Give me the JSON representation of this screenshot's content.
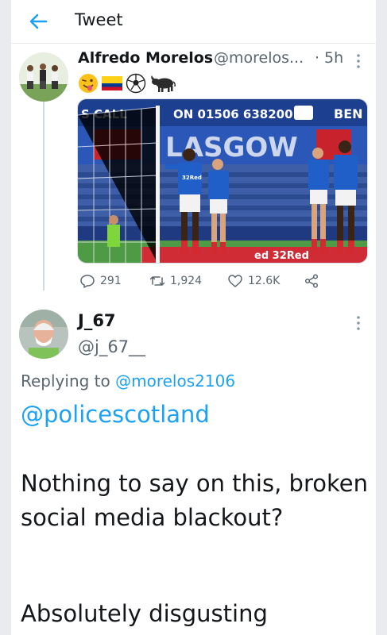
{
  "header": {
    "title": "Tweet"
  },
  "tweet": {
    "author_name": "Alfredo Morelos",
    "author_handle": "@morelos...",
    "separator": "·",
    "time": "5h",
    "emoji_icons": [
      "face-with-tongue-wink",
      "colombia-flag",
      "soccer-ball",
      "bull"
    ],
    "media": {
      "banner_left": "S CALL",
      "banner_phone": "ON 01506 638200",
      "banner_right": "BEN",
      "wall_text": "LASGOW",
      "sponsor_bottom": "32Red",
      "sponsor_bottom_small": "ed 32Red"
    },
    "stats": {
      "replies": "291",
      "retweets": "1,924",
      "likes": "12.6K"
    }
  },
  "reply": {
    "author_name": "J_67",
    "author_handle": "@j_67__",
    "replying_prefix": "Replying to",
    "replying_to": "@morelos2106",
    "mention": "@policescotland",
    "text_line1": "Nothing to say on this, broken social media blackout?",
    "text_line2": "Absolutely disgusting"
  },
  "colors": {
    "accent": "#1da1f2",
    "muted": "#5b6670",
    "divider": "#e6ecf0"
  }
}
